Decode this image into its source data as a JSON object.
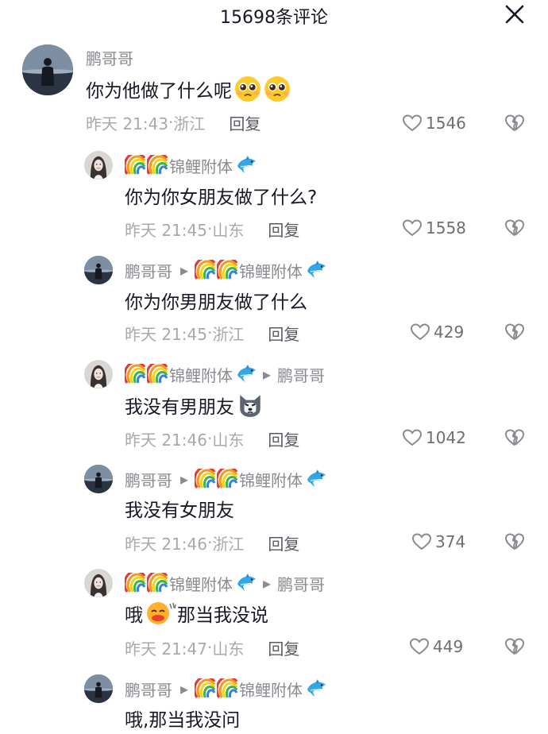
{
  "header": {
    "title": "15698条评论"
  },
  "comments": [
    {
      "user": "鹏哥哥",
      "to": "",
      "text": "你为他做了什么呢",
      "time": "昨天 21:43",
      "loc": "浙江",
      "reply": "回复",
      "likes": "1546"
    },
    {
      "user": "锦鲤附体",
      "to": "",
      "text": "你为你女朋友做了什么?",
      "time": "昨天 21:45",
      "loc": "山东",
      "reply": "回复",
      "likes": "1558"
    },
    {
      "user": "鹏哥哥",
      "to": "锦鲤附体",
      "text": "你为你男朋友做了什么",
      "time": "昨天 21:45",
      "loc": "浙江",
      "reply": "回复",
      "likes": "429"
    },
    {
      "user": "锦鲤附体",
      "to": "鹏哥哥",
      "text": "我没有男朋友",
      "time": "昨天 21:46",
      "loc": "山东",
      "reply": "回复",
      "likes": "1042"
    },
    {
      "user": "鹏哥哥",
      "to": "锦鲤附体",
      "text": "我没有女朋友",
      "time": "昨天 21:46",
      "loc": "浙江",
      "reply": "回复",
      "likes": "374"
    },
    {
      "user": "锦鲤附体",
      "to": "鹏哥哥",
      "text_a": "哦",
      "text_b": "那当我没说",
      "time": "昨天 21:47",
      "loc": "山东",
      "reply": "回复",
      "likes": "449"
    },
    {
      "user": "鹏哥哥",
      "to": "锦鲤附体",
      "text": "哦,那当我没问"
    }
  ],
  "icons": {
    "like": "heart-outline-icon",
    "dislike": "broken-heart-icon",
    "close": "close-icon",
    "rainbow": "rainbow-emoji",
    "dolphin": "dolphin-emoji"
  }
}
